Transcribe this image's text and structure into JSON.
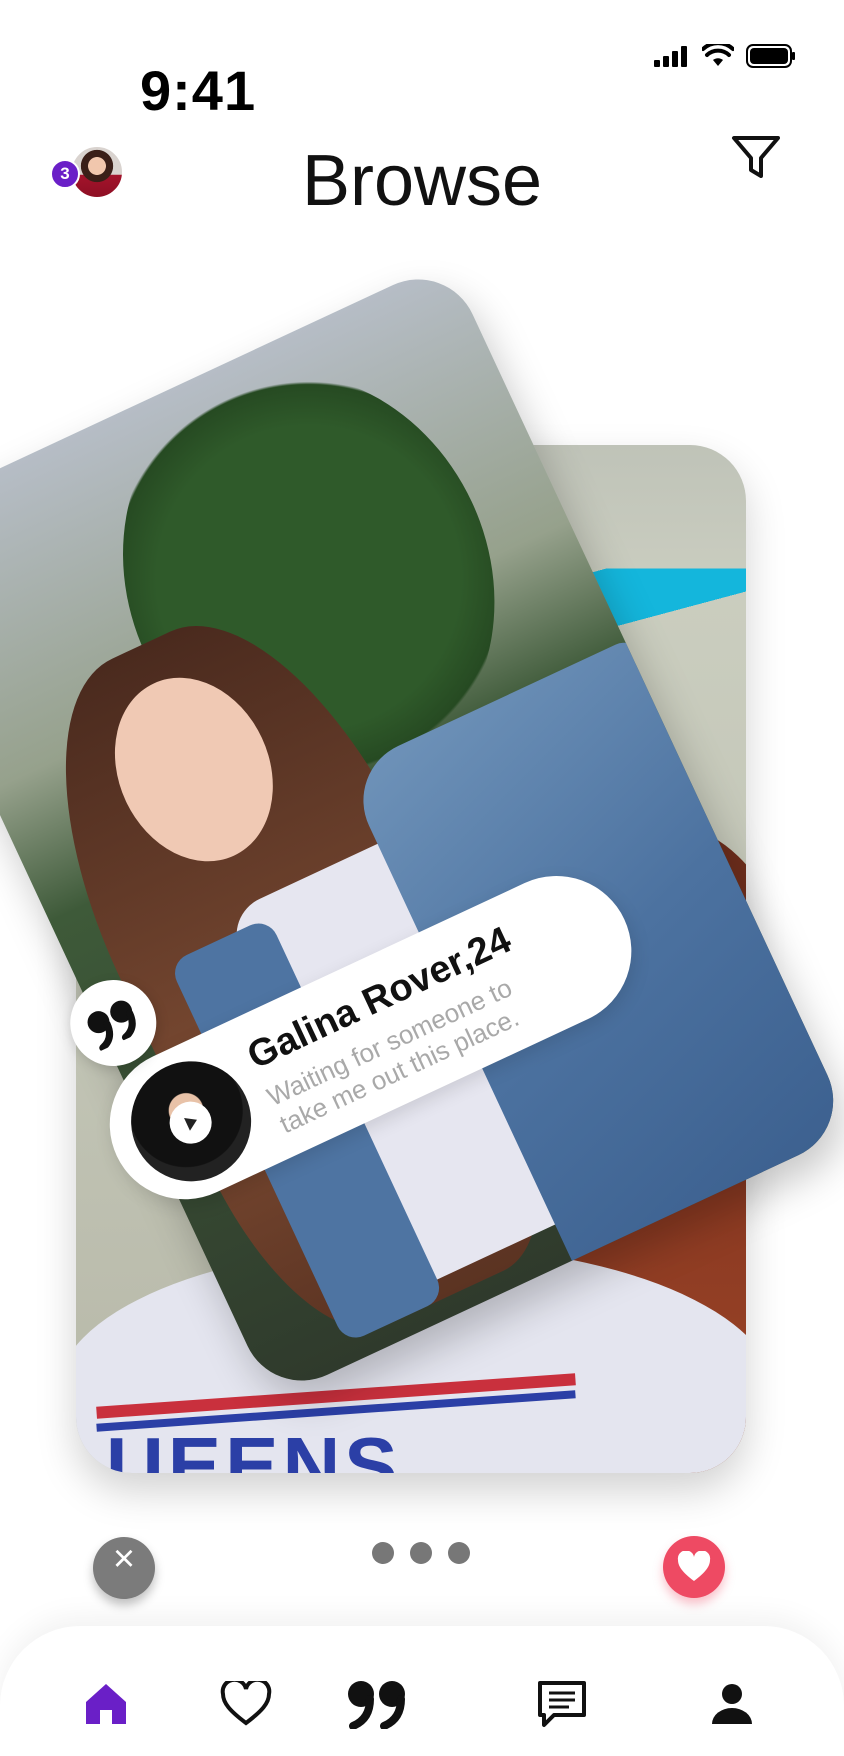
{
  "status_bar": {
    "time": "9:41"
  },
  "header": {
    "title": "Browse",
    "notification_count": "3"
  },
  "profile_card": {
    "name": "Galina Rover,24",
    "bio": "Waiting for someone to take me out this place."
  },
  "back_card": {
    "shirt_text": "UEENS"
  },
  "actions": {
    "reject_symbol": "×"
  },
  "pager": {
    "dots": 3
  },
  "colors": {
    "accent_purple": "#6a1fc7",
    "like_red": "#ee4a63",
    "reject_gray": "#7b7b7b"
  },
  "bottom_nav": {
    "items": [
      {
        "name": "home-icon",
        "active": true
      },
      {
        "name": "heart-icon",
        "active": false
      },
      {
        "name": "quote-icon",
        "active": false
      },
      {
        "name": "chat-icon",
        "active": false
      },
      {
        "name": "profile-icon",
        "active": false
      }
    ]
  }
}
